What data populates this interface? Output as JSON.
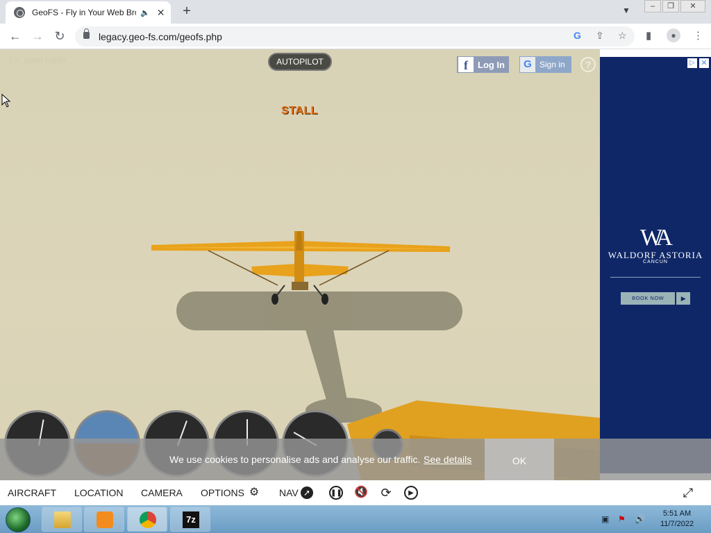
{
  "browser": {
    "tab_title": "GeoFS - Fly in Your Web Bro",
    "url": "legacy.geo-fs.com/geofs.php"
  },
  "game": {
    "autopilot_label": "AUTOPILOT",
    "stall_warning": "STALL",
    "facebook_label": "Log In",
    "google_label": "Sign in",
    "help_label": "?",
    "faint_text": "Ex: pixel calibr"
  },
  "ad": {
    "brand": "WALDORF ASTORIA",
    "city": "CANCUN",
    "cta": "BOOK NOW"
  },
  "cookie_banner": {
    "text": "We use cookies to personalise ads and analyse our traffic.",
    "link": "See details",
    "ok": "OK"
  },
  "bottom_nav": {
    "aircraft": "AIRCRAFT",
    "location": "LOCATION",
    "camera": "CAMERA",
    "options": "OPTIONS",
    "nav": "NAV"
  },
  "taskbar": {
    "time": "5:51 AM",
    "date": "11/7/2022",
    "sevenzip_label": "7z"
  },
  "icons": [
    "back-icon",
    "forward-icon",
    "reload-icon",
    "lock-icon",
    "google-icon",
    "share-icon",
    "star-icon",
    "side-panel-icon",
    "profile-icon",
    "menu-icon",
    "gear-icon",
    "compass-icon",
    "pause-icon",
    "mute-icon",
    "reset-icon",
    "play-icon",
    "fullscreen-icon"
  ]
}
